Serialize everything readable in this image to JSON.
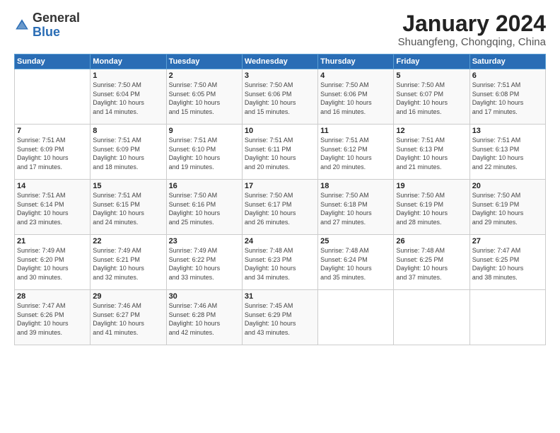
{
  "logo": {
    "general": "General",
    "blue": "Blue"
  },
  "title": "January 2024",
  "subtitle": "Shuangfeng, Chongqing, China",
  "headers": [
    "Sunday",
    "Monday",
    "Tuesday",
    "Wednesday",
    "Thursday",
    "Friday",
    "Saturday"
  ],
  "weeks": [
    [
      {
        "day": "",
        "info": ""
      },
      {
        "day": "1",
        "info": "Sunrise: 7:50 AM\nSunset: 6:04 PM\nDaylight: 10 hours\nand 14 minutes."
      },
      {
        "day": "2",
        "info": "Sunrise: 7:50 AM\nSunset: 6:05 PM\nDaylight: 10 hours\nand 15 minutes."
      },
      {
        "day": "3",
        "info": "Sunrise: 7:50 AM\nSunset: 6:06 PM\nDaylight: 10 hours\nand 15 minutes."
      },
      {
        "day": "4",
        "info": "Sunrise: 7:50 AM\nSunset: 6:06 PM\nDaylight: 10 hours\nand 16 minutes."
      },
      {
        "day": "5",
        "info": "Sunrise: 7:50 AM\nSunset: 6:07 PM\nDaylight: 10 hours\nand 16 minutes."
      },
      {
        "day": "6",
        "info": "Sunrise: 7:51 AM\nSunset: 6:08 PM\nDaylight: 10 hours\nand 17 minutes."
      }
    ],
    [
      {
        "day": "7",
        "info": "Sunrise: 7:51 AM\nSunset: 6:09 PM\nDaylight: 10 hours\nand 17 minutes."
      },
      {
        "day": "8",
        "info": "Sunrise: 7:51 AM\nSunset: 6:09 PM\nDaylight: 10 hours\nand 18 minutes."
      },
      {
        "day": "9",
        "info": "Sunrise: 7:51 AM\nSunset: 6:10 PM\nDaylight: 10 hours\nand 19 minutes."
      },
      {
        "day": "10",
        "info": "Sunrise: 7:51 AM\nSunset: 6:11 PM\nDaylight: 10 hours\nand 20 minutes."
      },
      {
        "day": "11",
        "info": "Sunrise: 7:51 AM\nSunset: 6:12 PM\nDaylight: 10 hours\nand 20 minutes."
      },
      {
        "day": "12",
        "info": "Sunrise: 7:51 AM\nSunset: 6:13 PM\nDaylight: 10 hours\nand 21 minutes."
      },
      {
        "day": "13",
        "info": "Sunrise: 7:51 AM\nSunset: 6:13 PM\nDaylight: 10 hours\nand 22 minutes."
      }
    ],
    [
      {
        "day": "14",
        "info": "Sunrise: 7:51 AM\nSunset: 6:14 PM\nDaylight: 10 hours\nand 23 minutes."
      },
      {
        "day": "15",
        "info": "Sunrise: 7:51 AM\nSunset: 6:15 PM\nDaylight: 10 hours\nand 24 minutes."
      },
      {
        "day": "16",
        "info": "Sunrise: 7:50 AM\nSunset: 6:16 PM\nDaylight: 10 hours\nand 25 minutes."
      },
      {
        "day": "17",
        "info": "Sunrise: 7:50 AM\nSunset: 6:17 PM\nDaylight: 10 hours\nand 26 minutes."
      },
      {
        "day": "18",
        "info": "Sunrise: 7:50 AM\nSunset: 6:18 PM\nDaylight: 10 hours\nand 27 minutes."
      },
      {
        "day": "19",
        "info": "Sunrise: 7:50 AM\nSunset: 6:19 PM\nDaylight: 10 hours\nand 28 minutes."
      },
      {
        "day": "20",
        "info": "Sunrise: 7:50 AM\nSunset: 6:19 PM\nDaylight: 10 hours\nand 29 minutes."
      }
    ],
    [
      {
        "day": "21",
        "info": "Sunrise: 7:49 AM\nSunset: 6:20 PM\nDaylight: 10 hours\nand 30 minutes."
      },
      {
        "day": "22",
        "info": "Sunrise: 7:49 AM\nSunset: 6:21 PM\nDaylight: 10 hours\nand 32 minutes."
      },
      {
        "day": "23",
        "info": "Sunrise: 7:49 AM\nSunset: 6:22 PM\nDaylight: 10 hours\nand 33 minutes."
      },
      {
        "day": "24",
        "info": "Sunrise: 7:48 AM\nSunset: 6:23 PM\nDaylight: 10 hours\nand 34 minutes."
      },
      {
        "day": "25",
        "info": "Sunrise: 7:48 AM\nSunset: 6:24 PM\nDaylight: 10 hours\nand 35 minutes."
      },
      {
        "day": "26",
        "info": "Sunrise: 7:48 AM\nSunset: 6:25 PM\nDaylight: 10 hours\nand 37 minutes."
      },
      {
        "day": "27",
        "info": "Sunrise: 7:47 AM\nSunset: 6:25 PM\nDaylight: 10 hours\nand 38 minutes."
      }
    ],
    [
      {
        "day": "28",
        "info": "Sunrise: 7:47 AM\nSunset: 6:26 PM\nDaylight: 10 hours\nand 39 minutes."
      },
      {
        "day": "29",
        "info": "Sunrise: 7:46 AM\nSunset: 6:27 PM\nDaylight: 10 hours\nand 41 minutes."
      },
      {
        "day": "30",
        "info": "Sunrise: 7:46 AM\nSunset: 6:28 PM\nDaylight: 10 hours\nand 42 minutes."
      },
      {
        "day": "31",
        "info": "Sunrise: 7:45 AM\nSunset: 6:29 PM\nDaylight: 10 hours\nand 43 minutes."
      },
      {
        "day": "",
        "info": ""
      },
      {
        "day": "",
        "info": ""
      },
      {
        "day": "",
        "info": ""
      }
    ]
  ]
}
